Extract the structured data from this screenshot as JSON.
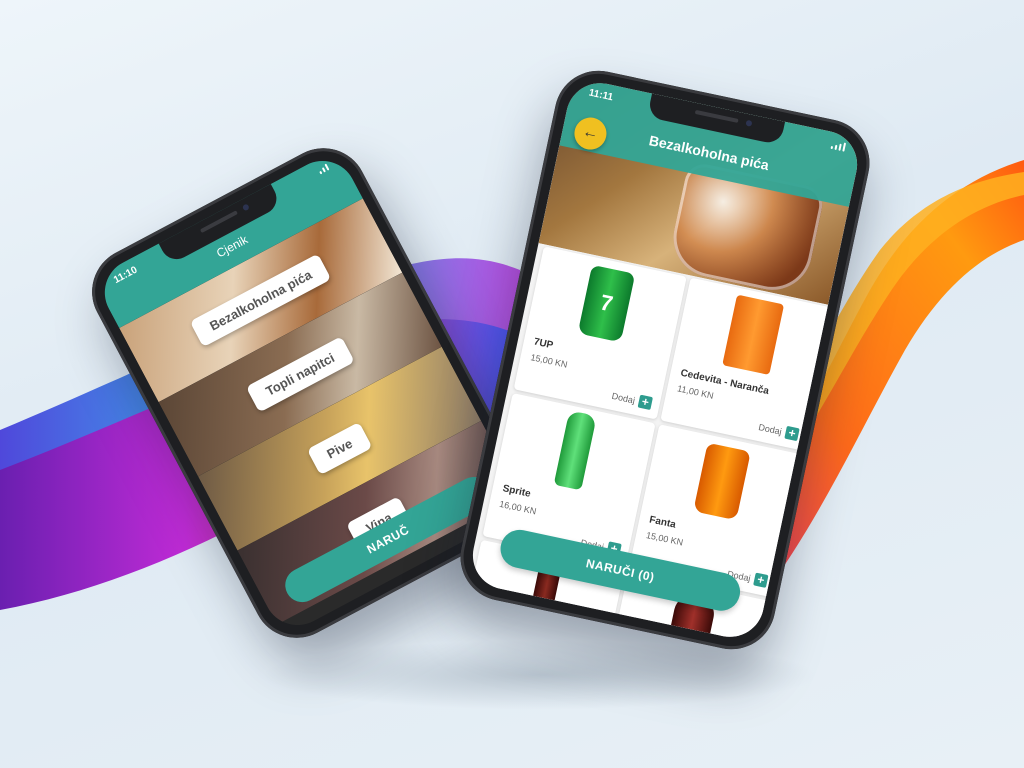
{
  "colors": {
    "primary": "#33a596",
    "back_button": "#f0c020",
    "add_button": "#2e9c8e"
  },
  "phone1": {
    "status_time": "11:10",
    "header_title": "Cjenik",
    "categories": [
      {
        "label": "Bezalkoholna pića"
      },
      {
        "label": "Topli napitci"
      },
      {
        "label": "Pive"
      },
      {
        "label": "Vina"
      }
    ],
    "order_label": "NARUČ"
  },
  "phone2": {
    "status_time": "11:11",
    "header_title": "Bezalkoholna pića",
    "back_icon": "arrow-left-icon",
    "products": [
      {
        "name": "7UP",
        "price": "15,00 KN",
        "add_label": "Dodaj"
      },
      {
        "name": "Cedevita - Naranča",
        "price": "11,00 KN",
        "add_label": "Dodaj"
      },
      {
        "name": "Sprite",
        "price": "16,00 KN",
        "add_label": "Dodaj"
      },
      {
        "name": "Fanta",
        "price": "15,00 KN",
        "add_label": "Dodaj"
      }
    ],
    "order_label": "NARUČI (0)"
  }
}
